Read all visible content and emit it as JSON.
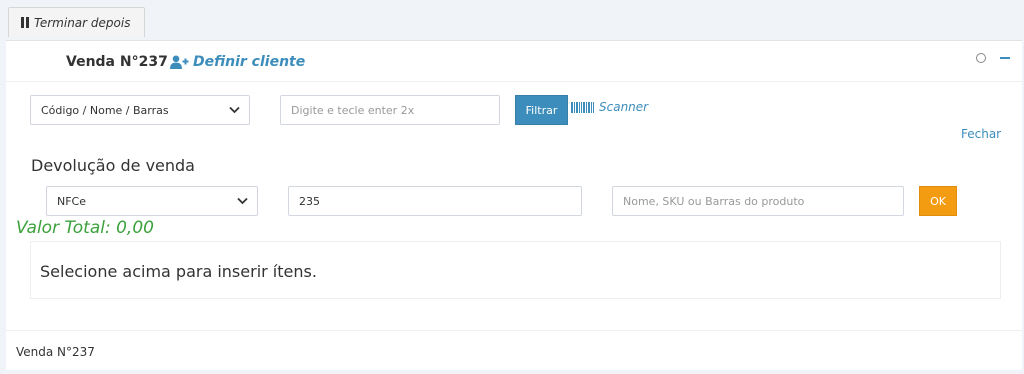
{
  "top_button": {
    "label": "Terminar depois",
    "icon": "pause-icon"
  },
  "header": {
    "title": "Venda N°237",
    "define_client": "Definir cliente",
    "define_client_icon": "user-plus-icon"
  },
  "search": {
    "type_selected": "Código / Nome / Barras",
    "input_placeholder": "Digite e tecle enter 2x",
    "filter_button": "Filtrar",
    "scanner_label": "Scanner"
  },
  "close_link": "Fechar",
  "return_section": {
    "title": "Devolução de venda",
    "doc_type_selected": "NFCe",
    "doc_number": "235",
    "product_placeholder": "Nome, SKU ou Barras do produto",
    "ok_button": "OK"
  },
  "total": "Valor Total: 0,00",
  "items_message": "Selecione acima para inserir ítens.",
  "footer": {
    "label": "Venda N°237"
  },
  "colors": {
    "accent": "#3c8dbc",
    "ok": "#f39c12",
    "total": "#3ba13b"
  }
}
